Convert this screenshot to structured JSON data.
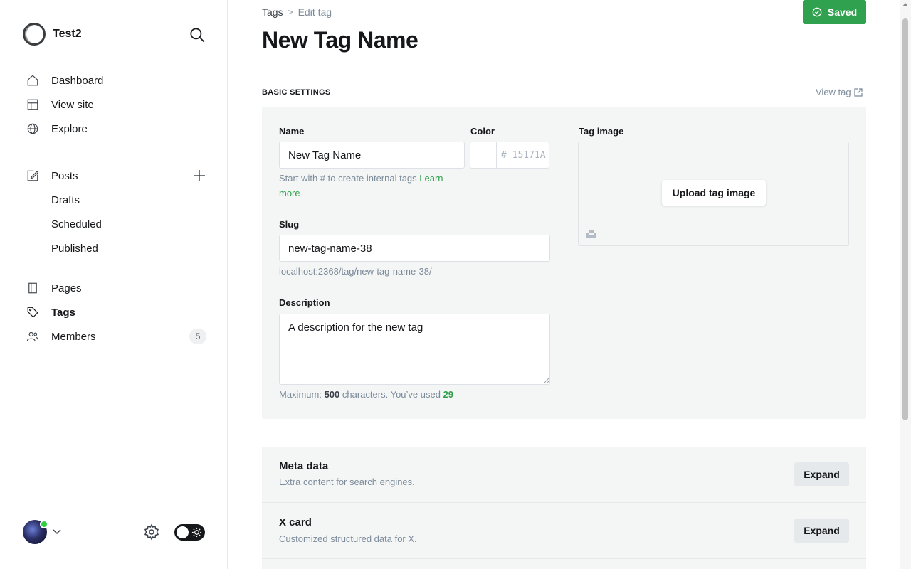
{
  "sidebar": {
    "site_name": "Test2",
    "nav": [
      {
        "label": "Dashboard",
        "icon": "home-icon"
      },
      {
        "label": "View site",
        "icon": "layout-icon"
      },
      {
        "label": "Explore",
        "icon": "globe-icon"
      }
    ],
    "posts": {
      "label": "Posts",
      "icon": "edit-icon",
      "sub": [
        "Drafts",
        "Scheduled",
        "Published"
      ]
    },
    "nav2": [
      {
        "label": "Pages",
        "icon": "page-icon"
      },
      {
        "label": "Tags",
        "icon": "tag-icon"
      },
      {
        "label": "Members",
        "icon": "members-icon",
        "badge": "5"
      }
    ]
  },
  "breadcrumb": {
    "parent": "Tags",
    "separator": ">",
    "current": "Edit tag"
  },
  "saved_label": "Saved",
  "page_title": "New Tag Name",
  "section_label": "Basic settings",
  "view_tag_label": "View tag",
  "form": {
    "name_label": "Name",
    "name_value": "New Tag Name",
    "name_hint": "Start with # to create internal tags",
    "learn_more": "Learn more",
    "color_label": "Color",
    "color_hash": "#",
    "color_placeholder": "15171A",
    "tag_image_label": "Tag image",
    "upload_label": "Upload tag image",
    "slug_label": "Slug",
    "slug_value": "new-tag-name-38",
    "slug_url": "localhost:2368/tag/new-tag-name-38/",
    "description_label": "Description",
    "description_value": "A description for the new tag",
    "desc_hint_prefix": "Maximum:",
    "desc_max": "500",
    "desc_hint_mid": "characters. You’ve used",
    "desc_used": "29"
  },
  "accordions": [
    {
      "title": "Meta data",
      "subtitle": "Extra content for search engines.",
      "button": "Expand"
    },
    {
      "title": "X card",
      "subtitle": "Customized structured data for X.",
      "button": "Expand"
    }
  ],
  "colors": {
    "accent_green": "#30a14e",
    "panel_bg": "#f4f5f5",
    "text": "#15171a",
    "muted": "#7c8b9a"
  }
}
